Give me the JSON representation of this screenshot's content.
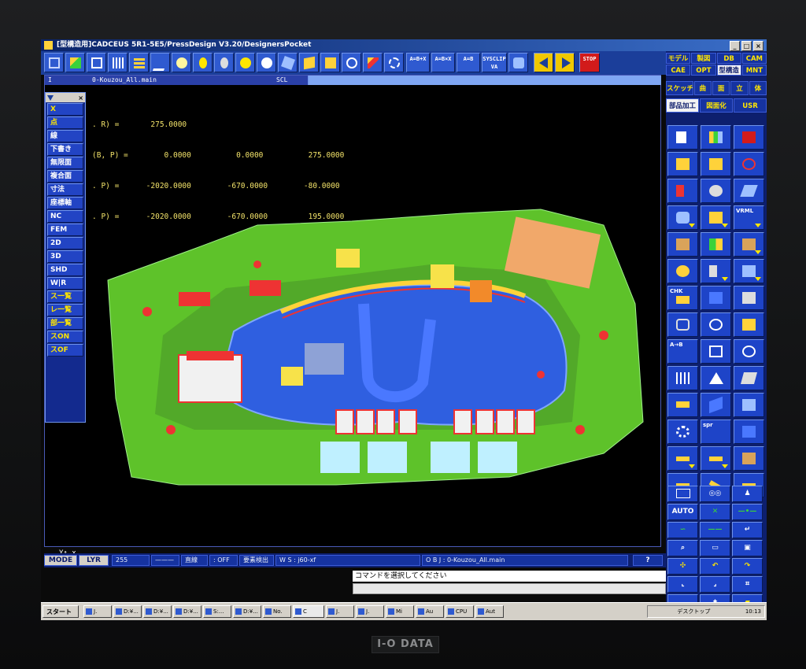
{
  "window": {
    "title": "[型構造用]CADCEUS 5R1-5E5/PressDesign V3.20/DesignersPocket",
    "buttons": [
      "_",
      "□",
      "×"
    ]
  },
  "toolbar": {
    "labels": [
      "A=B+X",
      "A=B×X",
      "A=B",
      "SYSCLIP VA",
      "STOP"
    ]
  },
  "right_panel": {
    "menu_rows": [
      [
        "モデル",
        "製図",
        "DB",
        "CAM"
      ],
      [
        "CAE",
        "OPT",
        "型構造",
        "MNT"
      ],
      [
        "スケッチ",
        "曲",
        "面",
        "立",
        "体"
      ],
      [
        "部品加工",
        "図面化",
        "USR"
      ]
    ],
    "active": [
      "型構造",
      "部品加工"
    ],
    "button_labels": [
      "VRML",
      "CHK",
      "A→B",
      "spr"
    ],
    "lower_button_labels": [
      "AUTO"
    ]
  },
  "viewport": {
    "header_left": "I",
    "header_file": "0-Kouzou_All.main",
    "header_scl": "SCL",
    "coords": [
      [
        ". R) =",
        "275.0000",
        "",
        ""
      ],
      [
        "(B, P) =",
        "0.0000",
        "0.0000",
        "275.0000"
      ],
      [
        ". P) =",
        "-2020.0000",
        "-670.0000",
        "-80.0000"
      ],
      [
        ". P) =",
        "-2020.0000",
        "-670.0000",
        "195.0000"
      ]
    ],
    "axis_label": "x"
  },
  "side_menu": {
    "items": [
      "X",
      "点",
      "線",
      "下書き",
      "無限面",
      "複合面",
      "寸法",
      "座標軸",
      "NC",
      "FEM",
      "2D",
      "3D",
      "SHD",
      "W|R",
      "ス一覧",
      "レ一覧",
      "部一覧",
      "スON",
      "スOF"
    ]
  },
  "status": {
    "mode": "MODE",
    "lyr": "LYR",
    "layer_no": "255",
    "line": "———",
    "f1": "直線",
    "f2": ": OFF",
    "f3": "要素検出",
    "ws": "W S : j60-xf",
    "obj": "O B J : 0-Kouzou_All.main",
    "help": "?"
  },
  "command": {
    "prompt": "コマンドを選択してください"
  },
  "taskbar": {
    "start": "スタート",
    "items": [
      "J.",
      "D:¥...",
      "D:¥...",
      "D:¥...",
      "S:...",
      "D:¥...",
      "No.",
      "C",
      "J.",
      "J.",
      "Mi",
      "Au",
      "CPU",
      "Aut"
    ],
    "tray_text": "デスクトップ",
    "clock": "10:13"
  },
  "brand": "I-O DATA",
  "colors": {
    "panel_blue": "#1e44c8",
    "accent_yellow": "#ffe600",
    "model_green": "#5ec22a",
    "model_blue": "#2f5fe0"
  }
}
